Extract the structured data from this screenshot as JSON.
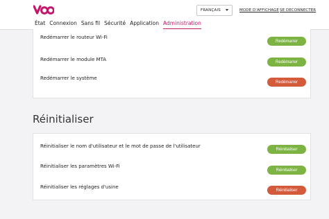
{
  "brand": {
    "logo_text": "VOO",
    "accent": "#c4166b"
  },
  "header": {
    "language": "FRANÇAIS",
    "display_mode": "MODE D'AFFICHAGE",
    "logout": "SE DECONNECTER"
  },
  "nav": {
    "tabs": [
      {
        "label": "État"
      },
      {
        "label": "Connexion"
      },
      {
        "label": "Sans fil"
      },
      {
        "label": "Sécurité"
      },
      {
        "label": "Application"
      },
      {
        "label": "Administration"
      }
    ],
    "active": "Administration"
  },
  "restart": {
    "rows": [
      {
        "label": "Redémarrer le routeur Wi-Fi",
        "button": "Redémarrer",
        "color": "#7cb342"
      },
      {
        "label": "Redémarrer le module MTA",
        "button": "Redémarrer",
        "color": "#7cb342"
      },
      {
        "label": "Redémarrer le système",
        "button": "Redémarrer",
        "color": "#d45a3c"
      }
    ]
  },
  "reset": {
    "title": "Réinitialiser",
    "rows": [
      {
        "label": "Réinitialiser le nom d'utilisateur et le mot de passe de l'utilisateur",
        "button": "Réinitialiser",
        "color": "#7cb342"
      },
      {
        "label": "Réinitialiser les paramètres Wi-Fi",
        "button": "Réinitialiser",
        "color": "#7cb342"
      },
      {
        "label": "Réinitialiser les réglages d'usine",
        "button": "Réinitialiser",
        "color": "#d45a3c"
      }
    ]
  }
}
